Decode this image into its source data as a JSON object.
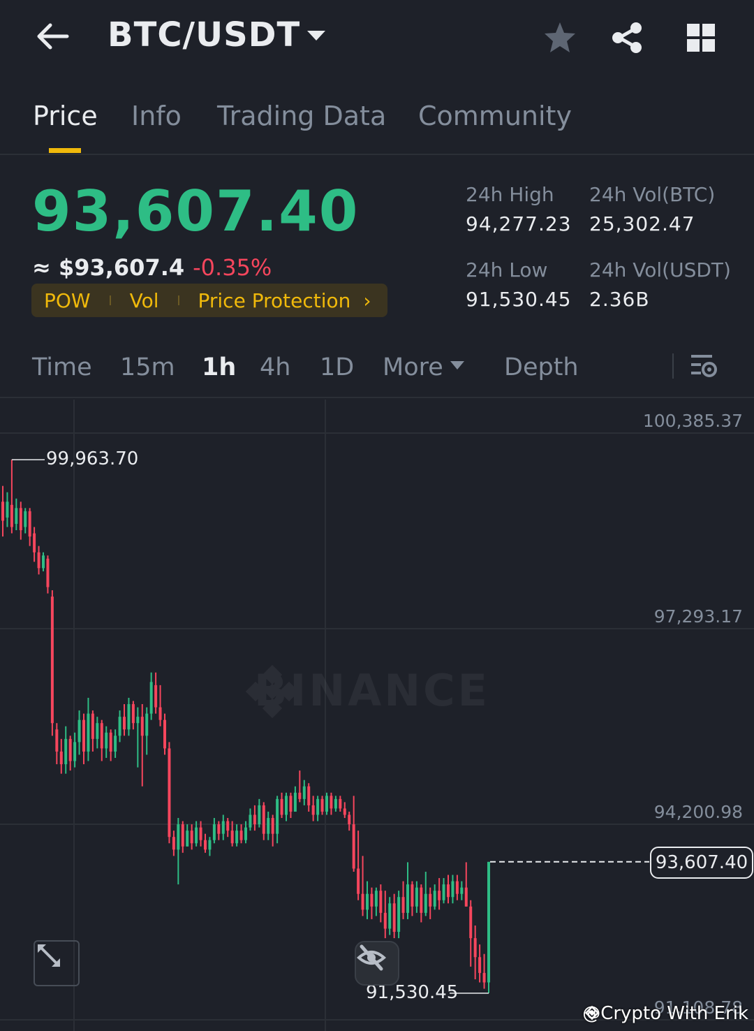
{
  "header": {
    "pair": "BTC/USDT",
    "icons": [
      "back-arrow-icon",
      "caret-down-icon",
      "star-icon",
      "share-icon",
      "grid-icon"
    ]
  },
  "tabs": [
    {
      "label": "Price",
      "active": true
    },
    {
      "label": "Info",
      "active": false
    },
    {
      "label": "Trading Data",
      "active": false
    },
    {
      "label": "Community",
      "active": false
    }
  ],
  "price": {
    "last": "93,607.40",
    "usd_prefix": "≈ ",
    "usd": "$93,607.4",
    "change_pct": "-0.35%",
    "tags": [
      "POW",
      "Vol",
      "Price Protection"
    ]
  },
  "stats": {
    "high_label": "24h High",
    "high": "94,277.23",
    "low_label": "24h Low",
    "low": "91,530.45",
    "vol_btc_label": "24h Vol(BTC)",
    "vol_btc": "25,302.47",
    "vol_usdt_label": "24h Vol(USDT)",
    "vol_usdt": "2.36B"
  },
  "intervals": {
    "items": [
      "Time",
      "15m",
      "1h",
      "4h",
      "1D"
    ],
    "active": "1h",
    "more": "More",
    "depth": "Depth"
  },
  "chart": {
    "y_labels": [
      "100,385.37",
      "97,293.17",
      "94,200.98",
      "91,108.78"
    ],
    "high_marker": "99,963.70",
    "low_marker": "91,530.45",
    "current": "93,607.40",
    "watermark": "BINANCE",
    "credit": "@Crypto With Erik"
  },
  "colors": {
    "up": "#2ebd85",
    "down": "#f6465d",
    "accent": "#f0b90b",
    "background": "#1e2129"
  },
  "chart_data": {
    "type": "candlestick",
    "interval": "1h",
    "y_ticks": [
      100385.37,
      97293.17,
      94200.98,
      91108.78
    ],
    "ylim": [
      91100,
      100400
    ],
    "period_high": 99963.7,
    "period_low": 91530.45,
    "last_price": 93607.4,
    "candles": [
      {
        "o": 99300,
        "c": 99000,
        "h": 99550,
        "l": 98750
      },
      {
        "o": 99050,
        "c": 99300,
        "h": 99450,
        "l": 98900
      },
      {
        "o": 99250,
        "c": 98900,
        "h": 99964,
        "l": 98800
      },
      {
        "o": 98950,
        "c": 99200,
        "h": 99350,
        "l": 98850
      },
      {
        "o": 99200,
        "c": 98850,
        "h": 99300,
        "l": 98700
      },
      {
        "o": 98900,
        "c": 99150,
        "h": 99200,
        "l": 98800
      },
      {
        "o": 99150,
        "c": 98750,
        "h": 99200,
        "l": 98600
      },
      {
        "o": 98800,
        "c": 98500,
        "h": 98900,
        "l": 98350
      },
      {
        "o": 98500,
        "c": 98250,
        "h": 98600,
        "l": 98150
      },
      {
        "o": 98250,
        "c": 98450,
        "h": 98500,
        "l": 98200
      },
      {
        "o": 98400,
        "c": 97950,
        "h": 98450,
        "l": 97850
      },
      {
        "o": 97800,
        "c": 95800,
        "h": 97900,
        "l": 95600
      },
      {
        "o": 95700,
        "c": 95350,
        "h": 95800,
        "l": 95150
      },
      {
        "o": 95350,
        "c": 95150,
        "h": 95550,
        "l": 95000
      },
      {
        "o": 95150,
        "c": 95550,
        "h": 95750,
        "l": 95000
      },
      {
        "o": 95550,
        "c": 95200,
        "h": 95600,
        "l": 95050
      },
      {
        "o": 95200,
        "c": 95500,
        "h": 95650,
        "l": 95100
      },
      {
        "o": 95500,
        "c": 95850,
        "h": 96000,
        "l": 95300
      },
      {
        "o": 95850,
        "c": 95350,
        "h": 95950,
        "l": 95150
      },
      {
        "o": 95350,
        "c": 95950,
        "h": 96200,
        "l": 95200
      },
      {
        "o": 95950,
        "c": 95550,
        "h": 96000,
        "l": 95350
      },
      {
        "o": 95550,
        "c": 95800,
        "h": 95900,
        "l": 95400
      },
      {
        "o": 95800,
        "c": 95400,
        "h": 95850,
        "l": 95200
      },
      {
        "o": 95400,
        "c": 95650,
        "h": 95750,
        "l": 95250
      },
      {
        "o": 95650,
        "c": 95350,
        "h": 95700,
        "l": 95200
      },
      {
        "o": 95350,
        "c": 95600,
        "h": 95700,
        "l": 95250
      },
      {
        "o": 95600,
        "c": 95900,
        "h": 96000,
        "l": 95500
      },
      {
        "o": 95900,
        "c": 95700,
        "h": 96100,
        "l": 95600
      },
      {
        "o": 95700,
        "c": 96100,
        "h": 96200,
        "l": 95600
      },
      {
        "o": 96100,
        "c": 95800,
        "h": 96150,
        "l": 95700
      },
      {
        "o": 95800,
        "c": 95900,
        "h": 96050,
        "l": 95100
      },
      {
        "o": 95900,
        "c": 95600,
        "h": 96100,
        "l": 94800
      },
      {
        "o": 95600,
        "c": 95950,
        "h": 96050,
        "l": 95300
      },
      {
        "o": 95950,
        "c": 96450,
        "h": 96600,
        "l": 95850
      },
      {
        "o": 96400,
        "c": 96050,
        "h": 96600,
        "l": 95950
      },
      {
        "o": 96050,
        "c": 95850,
        "h": 96400,
        "l": 95750
      },
      {
        "o": 95850,
        "c": 95400,
        "h": 95950,
        "l": 95300
      },
      {
        "o": 95400,
        "c": 94000,
        "h": 95500,
        "l": 93900
      },
      {
        "o": 94000,
        "c": 93800,
        "h": 94100,
        "l": 93700
      },
      {
        "o": 93800,
        "c": 94200,
        "h": 94300,
        "l": 93250
      },
      {
        "o": 94200,
        "c": 93850,
        "h": 94250,
        "l": 93750
      },
      {
        "o": 93850,
        "c": 94100,
        "h": 94200,
        "l": 93850
      },
      {
        "o": 94100,
        "c": 93900,
        "h": 94200,
        "l": 93800
      },
      {
        "o": 93900,
        "c": 94150,
        "h": 94250,
        "l": 93850
      },
      {
        "o": 94150,
        "c": 93950,
        "h": 94250,
        "l": 93850
      },
      {
        "o": 93950,
        "c": 93800,
        "h": 94050,
        "l": 93750
      },
      {
        "o": 93800,
        "c": 93950,
        "h": 94000,
        "l": 93700
      },
      {
        "o": 93950,
        "c": 94200,
        "h": 94300,
        "l": 93900
      },
      {
        "o": 94200,
        "c": 94050,
        "h": 94250,
        "l": 93950
      },
      {
        "o": 94050,
        "c": 94250,
        "h": 94350,
        "l": 93950
      },
      {
        "o": 94250,
        "c": 94100,
        "h": 94300,
        "l": 94000
      },
      {
        "o": 94100,
        "c": 93900,
        "h": 94250,
        "l": 93850
      },
      {
        "o": 93900,
        "c": 94100,
        "h": 94200,
        "l": 93850
      },
      {
        "o": 94100,
        "c": 93950,
        "h": 94200,
        "l": 93900
      },
      {
        "o": 93950,
        "c": 94150,
        "h": 94250,
        "l": 93900
      },
      {
        "o": 94150,
        "c": 94350,
        "h": 94450,
        "l": 94100
      },
      {
        "o": 94350,
        "c": 94200,
        "h": 94500,
        "l": 94100
      },
      {
        "o": 94200,
        "c": 94500,
        "h": 94600,
        "l": 94150
      },
      {
        "o": 94500,
        "c": 94050,
        "h": 94550,
        "l": 93950
      },
      {
        "o": 94050,
        "c": 94300,
        "h": 94400,
        "l": 93950
      },
      {
        "o": 94300,
        "c": 94050,
        "h": 94350,
        "l": 93850
      },
      {
        "o": 94050,
        "c": 94600,
        "h": 94650,
        "l": 93900
      },
      {
        "o": 94600,
        "c": 94350,
        "h": 94700,
        "l": 94300
      },
      {
        "o": 94350,
        "c": 94650,
        "h": 94700,
        "l": 94250
      },
      {
        "o": 94650,
        "c": 94400,
        "h": 94700,
        "l": 94300
      },
      {
        "o": 94400,
        "c": 94700,
        "h": 94800,
        "l": 94400
      },
      {
        "o": 94700,
        "c": 94600,
        "h": 95050,
        "l": 94550
      },
      {
        "o": 94600,
        "c": 94800,
        "h": 94900,
        "l": 94500
      },
      {
        "o": 94800,
        "c": 94500,
        "h": 94850,
        "l": 94400
      },
      {
        "o": 94500,
        "c": 94350,
        "h": 94650,
        "l": 94250
      },
      {
        "o": 94350,
        "c": 94600,
        "h": 94650,
        "l": 94250
      },
      {
        "o": 94600,
        "c": 94400,
        "h": 94650,
        "l": 94350
      },
      {
        "o": 94400,
        "c": 94650,
        "h": 94700,
        "l": 94350
      },
      {
        "o": 94650,
        "c": 94450,
        "h": 94700,
        "l": 94350
      },
      {
        "o": 94450,
        "c": 94600,
        "h": 94650,
        "l": 94400
      },
      {
        "o": 94600,
        "c": 94450,
        "h": 94650,
        "l": 94400
      },
      {
        "o": 94450,
        "c": 94350,
        "h": 94550,
        "l": 94300
      },
      {
        "o": 94350,
        "c": 94200,
        "h": 94400,
        "l": 94100
      },
      {
        "o": 94200,
        "c": 93500,
        "h": 94650,
        "l": 93450
      },
      {
        "o": 93500,
        "c": 93100,
        "h": 94100,
        "l": 93000
      },
      {
        "o": 93100,
        "c": 92850,
        "h": 93700,
        "l": 92750
      },
      {
        "o": 92850,
        "c": 93100,
        "h": 93300,
        "l": 92700
      },
      {
        "o": 93100,
        "c": 92900,
        "h": 93200,
        "l": 92700
      },
      {
        "o": 92900,
        "c": 93150,
        "h": 93200,
        "l": 92750
      },
      {
        "o": 93150,
        "c": 92800,
        "h": 93250,
        "l": 92650
      },
      {
        "o": 92800,
        "c": 92550,
        "h": 93150,
        "l": 92400
      },
      {
        "o": 92550,
        "c": 92950,
        "h": 93050,
        "l": 92450
      },
      {
        "o": 92950,
        "c": 92500,
        "h": 93100,
        "l": 92400
      },
      {
        "o": 92500,
        "c": 93050,
        "h": 93150,
        "l": 92400
      },
      {
        "o": 93050,
        "c": 92800,
        "h": 93300,
        "l": 92700
      },
      {
        "o": 92800,
        "c": 93250,
        "h": 93600,
        "l": 92700
      },
      {
        "o": 93250,
        "c": 92900,
        "h": 93300,
        "l": 92750
      },
      {
        "o": 92900,
        "c": 93200,
        "h": 93300,
        "l": 92800
      },
      {
        "o": 93200,
        "c": 92800,
        "h": 93250,
        "l": 92650
      },
      {
        "o": 92800,
        "c": 93100,
        "h": 93450,
        "l": 92750
      },
      {
        "o": 93100,
        "c": 92900,
        "h": 93200,
        "l": 92700
      },
      {
        "o": 92900,
        "c": 93150,
        "h": 93250,
        "l": 92850
      },
      {
        "o": 93150,
        "c": 93000,
        "h": 93350,
        "l": 92850
      },
      {
        "o": 93000,
        "c": 93250,
        "h": 93350,
        "l": 92950
      },
      {
        "o": 93250,
        "c": 93050,
        "h": 93400,
        "l": 92950
      },
      {
        "o": 93050,
        "c": 93300,
        "h": 93400,
        "l": 92950
      },
      {
        "o": 93300,
        "c": 93100,
        "h": 93400,
        "l": 93000
      },
      {
        "o": 93100,
        "c": 93200,
        "h": 93300,
        "l": 93000
      },
      {
        "o": 93200,
        "c": 92900,
        "h": 93600,
        "l": 92900
      },
      {
        "o": 92900,
        "c": 92400,
        "h": 93000,
        "l": 91950
      },
      {
        "o": 92400,
        "c": 92100,
        "h": 92600,
        "l": 91750
      },
      {
        "o": 92100,
        "c": 91850,
        "h": 92300,
        "l": 91700
      },
      {
        "o": 91850,
        "c": 91700,
        "h": 92150,
        "l": 91600
      },
      {
        "o": 91700,
        "c": 93607,
        "h": 93600,
        "l": 91530
      }
    ]
  }
}
